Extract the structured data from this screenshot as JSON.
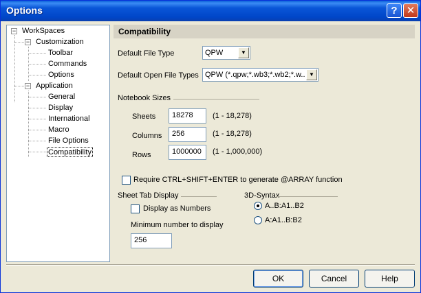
{
  "window": {
    "title": "Options",
    "help_glyph": "?",
    "close_glyph": "✕"
  },
  "tree": {
    "root": "WorkSpaces",
    "customization": {
      "label": "Customization",
      "children": [
        "Toolbar",
        "Commands",
        "Options"
      ]
    },
    "application": {
      "label": "Application",
      "children": [
        "General",
        "Display",
        "International",
        "Macro",
        "File Options",
        "Compatibility"
      ]
    },
    "selected": "Compatibility"
  },
  "section": {
    "title": "Compatibility"
  },
  "default_file_type": {
    "label": "Default File Type",
    "value": "QPW"
  },
  "default_open_file_types": {
    "label": "Default Open File Types",
    "value": "QPW (*.qpw;*.wb3;*.wb2;*.w..."
  },
  "notebook_sizes": {
    "label": "Notebook Sizes",
    "sheets": {
      "label": "Sheets",
      "value": "18278",
      "range": "(1 - 18,278)"
    },
    "columns": {
      "label": "Columns",
      "value": "256",
      "range": "(1 - 18,278)"
    },
    "rows": {
      "label": "Rows",
      "value": "1000000",
      "range": "(1 - 1,000,000)"
    }
  },
  "require_ctrl_shift_enter": {
    "label": "Require CTRL+SHIFT+ENTER to generate @ARRAY function",
    "checked": false
  },
  "sheet_tab_display": {
    "label": "Sheet Tab Display",
    "display_as_numbers": {
      "label": "Display as Numbers",
      "checked": false
    },
    "minimum_label": "Minimum number to display",
    "minimum_value": "256"
  },
  "syntax_3d": {
    "label": "3D-Syntax",
    "options": [
      {
        "label": "A..B:A1..B2",
        "selected": true
      },
      {
        "label": "A:A1..B:B2",
        "selected": false
      }
    ]
  },
  "buttons": {
    "ok": "OK",
    "cancel": "Cancel",
    "help": "Help"
  }
}
